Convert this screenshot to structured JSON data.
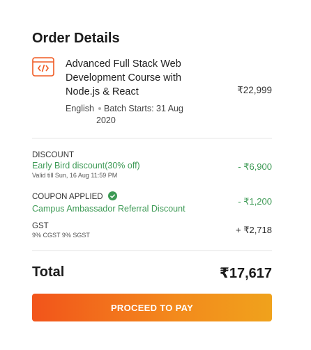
{
  "header": {
    "title": "Order Details"
  },
  "course": {
    "icon": "code-file-icon",
    "title": "Advanced Full Stack Web Development Course with Node.js & React",
    "price": "₹22,999",
    "language": "English",
    "batch_label": "Batch Starts:",
    "batch_date_part1": "31 Aug",
    "batch_date_part2": "2020"
  },
  "discount": {
    "label": "DISCOUNT",
    "name": "Early Bird discount(30% off)",
    "validity": "Valid till Sun, 16 Aug 11:59 PM",
    "amount": "- ₹6,900"
  },
  "coupon": {
    "label": "COUPON APPLIED",
    "icon": "check-circle-icon",
    "name": "Campus Ambassador Referral Discount",
    "amount": "- ₹1,200"
  },
  "gst": {
    "label": "GST",
    "breakdown": "9% CGST 9% SGST",
    "amount": "+ ₹2,718"
  },
  "total": {
    "label": "Total",
    "value": "₹17,617"
  },
  "action": {
    "proceed_label": "PROCEED TO PAY"
  },
  "colors": {
    "accent_orange": "#f2541b",
    "accent_amber": "#f0a21c",
    "discount_green": "#3d9a55"
  }
}
